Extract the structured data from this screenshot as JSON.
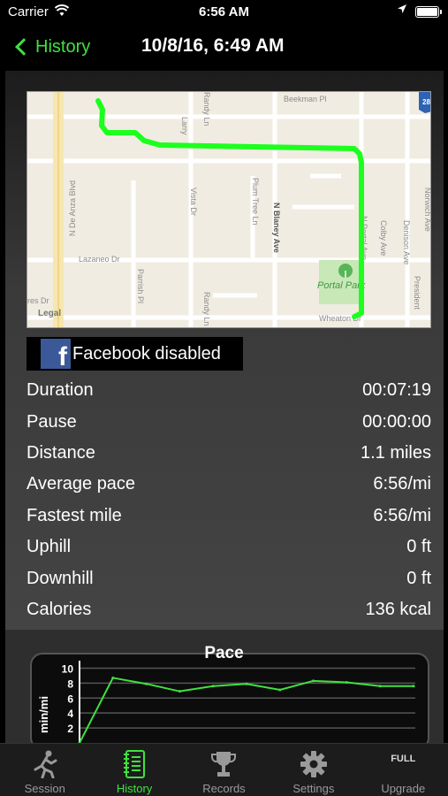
{
  "status": {
    "carrier": "Carrier",
    "time": "6:56 AM"
  },
  "nav": {
    "back_label": "History",
    "title": "10/8/16, 6:49 AM"
  },
  "map": {
    "labels": {
      "beekman": "Beekman Pl",
      "de_anza": "N De Anza Blvd",
      "larry": "Larry",
      "randy_top": "Randy Ln",
      "vista": "Vista Dr",
      "plum_tree": "Plum Tree Ln",
      "blaney": "N Blaney Ave",
      "portal": "N Portal Ave",
      "colby": "Colby Ave",
      "denison": "Denison Ave",
      "norwich": "Norwich Ave",
      "lazaneo": "Lazaneo Dr",
      "parrish": "Parrish Pl",
      "randy_bottom": "Randy Ln",
      "portal_park": "Portal Park",
      "wheaton": "Wheaton Dr",
      "res_dr": "res Dr",
      "president": "President",
      "legal": "Legal",
      "shield": "280"
    }
  },
  "facebook": {
    "label": "Facebook disabled"
  },
  "stats": [
    {
      "label": "Duration",
      "value": "00:07:19"
    },
    {
      "label": "Pause",
      "value": "00:00:00"
    },
    {
      "label": "Distance",
      "value": "1.1 miles"
    },
    {
      "label": "Average pace",
      "value": "6:56/mi"
    },
    {
      "label": "Fastest mile",
      "value": "6:56/mi"
    },
    {
      "label": "Uphill",
      "value": "0 ft"
    },
    {
      "label": "Downhill",
      "value": "0 ft"
    },
    {
      "label": "Calories",
      "value": "136 kcal"
    }
  ],
  "chart_data": {
    "type": "line",
    "title": "Pace",
    "ylabel": "min/mi",
    "yticks": [
      "10",
      "8",
      "6",
      "4",
      "2"
    ],
    "ylim": [
      0,
      11
    ],
    "series": [
      {
        "values": [
          0,
          8.7,
          7.9,
          6.9,
          7.6,
          7.9,
          7.1,
          8.3,
          8.1,
          7.6,
          7.6
        ]
      }
    ],
    "color": "#3fe23f"
  },
  "tabs": [
    {
      "label": "Session",
      "icon": "runner-icon"
    },
    {
      "label": "History",
      "icon": "notebook-icon",
      "active": true
    },
    {
      "label": "Records",
      "icon": "trophy-icon"
    },
    {
      "label": "Settings",
      "icon": "gear-icon"
    },
    {
      "label": "Upgrade",
      "icon": "full-text-icon",
      "icon_text": "FULL"
    }
  ]
}
